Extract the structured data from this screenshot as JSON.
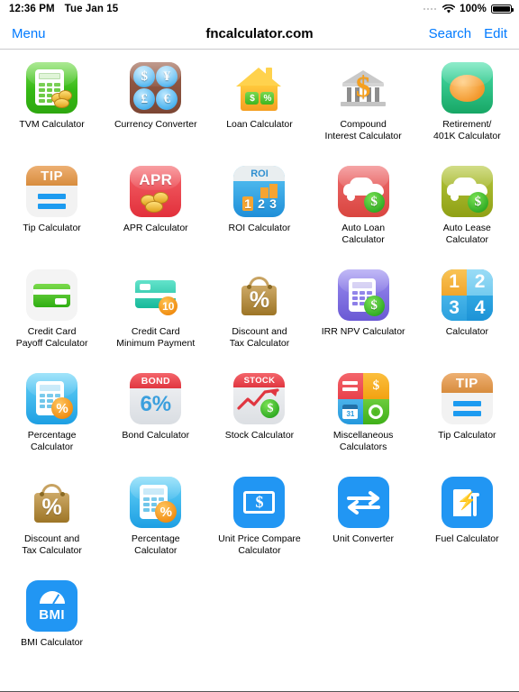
{
  "status_bar": {
    "time": "12:36 PM",
    "date": "Tue Jan 15",
    "battery_percent": "100%",
    "wifi_icon": "wifi-icon",
    "battery_icon": "battery-icon"
  },
  "nav": {
    "menu_label": "Menu",
    "title": "fncalculator.com",
    "search_label": "Search",
    "edit_label": "Edit"
  },
  "colors": {
    "accent_blue": "#007aff",
    "background": "#ffffff",
    "nav_border": "#c9c9cd"
  },
  "apps": [
    {
      "label": "TVM Calculator",
      "icon": "tvm-calculator-icon"
    },
    {
      "label": "Currency Converter",
      "icon": "currency-converter-icon",
      "symbols": [
        "$",
        "¥",
        "£",
        "€"
      ]
    },
    {
      "label": "Loan Calculator",
      "icon": "loan-calculator-icon",
      "badges": [
        "$",
        "%"
      ]
    },
    {
      "label": "Compound\nInterest Calculator",
      "icon": "compound-interest-calculator-icon",
      "symbol": "$"
    },
    {
      "label": "Retirement/\n401K Calculator",
      "icon": "retirement-401k-calculator-icon"
    },
    {
      "label": "Tip Calculator",
      "icon": "tip-calculator-icon",
      "header": "TIP"
    },
    {
      "label": "APR Calculator",
      "icon": "apr-calculator-icon",
      "header": "APR"
    },
    {
      "label": "ROI Calculator",
      "icon": "roi-calculator-icon",
      "header": "ROI",
      "digits": [
        "1",
        "2",
        "3"
      ]
    },
    {
      "label": "Auto Loan\nCalculator",
      "icon": "auto-loan-calculator-icon",
      "badge": "$"
    },
    {
      "label": "Auto Lease\nCalculator",
      "icon": "auto-lease-calculator-icon",
      "badge": "$"
    },
    {
      "label": "Credit Card\nPayoff Calculator",
      "icon": "credit-card-payoff-calculator-icon"
    },
    {
      "label": "Credit Card\nMinimum Payment",
      "icon": "credit-card-minimum-payment-icon",
      "badge": "10"
    },
    {
      "label": "Discount and\nTax Calculator",
      "icon": "discount-tax-calculator-icon",
      "symbol": "%"
    },
    {
      "label": "IRR NPV Calculator",
      "icon": "irr-npv-calculator-icon",
      "badge": "$"
    },
    {
      "label": "Calculator",
      "icon": "calculator-icon",
      "digits": [
        "1",
        "2",
        "3",
        "4"
      ]
    },
    {
      "label": "Percentage\nCalculator",
      "icon": "percentage-calculator-icon",
      "badge": "%"
    },
    {
      "label": "Bond Calculator",
      "icon": "bond-calculator-icon",
      "header": "BOND",
      "value": "6%"
    },
    {
      "label": "Stock Calculator",
      "icon": "stock-calculator-icon",
      "header": "STOCK",
      "badge": "$"
    },
    {
      "label": "Miscellaneous\nCalculators",
      "icon": "miscellaneous-calculators-icon",
      "tiles": [
        "=",
        "31",
        "$",
        "gear"
      ]
    },
    {
      "label": "Tip Calculator",
      "icon": "tip-calculator-icon",
      "header": "TIP"
    },
    {
      "label": "Discount and\nTax Calculator",
      "icon": "discount-tax-calculator-icon",
      "symbol": "%"
    },
    {
      "label": "Percentage\nCalculator",
      "icon": "percentage-calculator-icon",
      "badge": "%"
    },
    {
      "label": "Unit Price Compare\nCalculator",
      "icon": "unit-price-compare-calculator-icon",
      "symbol": "$"
    },
    {
      "label": "Unit Converter",
      "icon": "unit-converter-icon"
    },
    {
      "label": "Fuel Calculator",
      "icon": "fuel-calculator-icon"
    },
    {
      "label": "BMI Calculator",
      "icon": "bmi-calculator-icon",
      "text": "BMI"
    }
  ]
}
